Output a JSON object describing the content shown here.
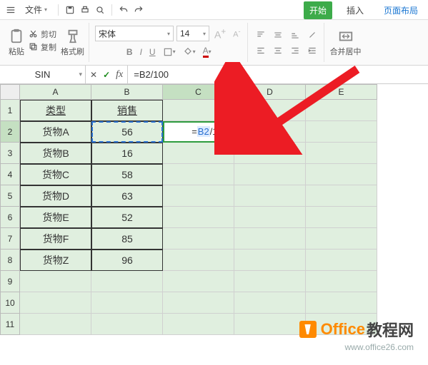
{
  "menu": {
    "file_label": "文件",
    "tabs": {
      "start": "开始",
      "insert": "插入",
      "layout": "页面布局"
    }
  },
  "ribbon": {
    "paste": "粘贴",
    "cut": "剪切",
    "copy": "复制",
    "format_painter": "格式刷",
    "font_name": "宋体",
    "font_size": "14",
    "merge_center": "合并居中"
  },
  "formula_bar": {
    "name_box": "SIN",
    "formula": "=B2/100",
    "eq": "=",
    "ref": "B2",
    "rest": "/100"
  },
  "grid": {
    "col_labels": [
      "A",
      "B",
      "C",
      "D",
      "E"
    ],
    "row_labels": [
      "1",
      "2",
      "3",
      "4",
      "5",
      "6",
      "7",
      "8",
      "9",
      "10",
      "11"
    ],
    "active_col_index": 2,
    "active_row_index": 1,
    "headers": {
      "a": "类型",
      "b": "销售"
    },
    "rows": [
      {
        "a": "货物A",
        "b": "56"
      },
      {
        "a": "货物B",
        "b": "16"
      },
      {
        "a": "货物C",
        "b": "58"
      },
      {
        "a": "货物D",
        "b": "63"
      },
      {
        "a": "货物E",
        "b": "52"
      },
      {
        "a": "货物F",
        "b": "85"
      },
      {
        "a": "货物Z",
        "b": "96"
      }
    ],
    "editing_cell": {
      "display_eq": "= ",
      "display_ref": "B2",
      "display_rest": " /100"
    }
  },
  "watermark": {
    "brand_orange": "Office",
    "brand_dark": "教程网",
    "url": "www.office26.com"
  },
  "colors": {
    "accent_green": "#3dab4a",
    "cell_bg": "#e0efdf",
    "ref_blue": "#2a70d0",
    "brand_orange": "#ff8a00",
    "arrow_red": "#ec1c24"
  }
}
